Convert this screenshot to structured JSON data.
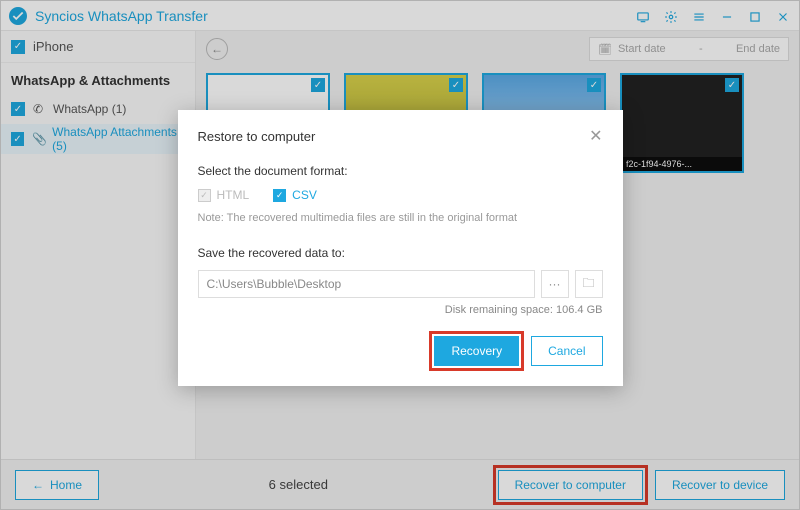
{
  "app": {
    "title": "Syncios WhatsApp Transfer"
  },
  "device": {
    "name": "iPhone"
  },
  "sidebar": {
    "section_title": "WhatsApp & Attachments",
    "items": [
      {
        "label": "WhatsApp (1)"
      },
      {
        "label": "WhatsApp Attachments (5)"
      }
    ]
  },
  "toolbar": {
    "start_date": "Start date",
    "dash": "-",
    "end_date": "End date"
  },
  "thumbs": [
    {
      "caption": ""
    },
    {
      "caption": ""
    },
    {
      "caption": ""
    },
    {
      "caption": "f2c-1f94-4976-..."
    }
  ],
  "footer": {
    "home": "Home",
    "selected": "6 selected",
    "recover_computer": "Recover to computer",
    "recover_device": "Recover to device"
  },
  "modal": {
    "title": "Restore to computer",
    "select_format": "Select the document format:",
    "html": "HTML",
    "csv": "CSV",
    "note": "Note: The recovered multimedia files are still in the original format",
    "save_to": "Save the recovered data to:",
    "path": "C:\\Users\\Bubble\\Desktop",
    "more": "···",
    "disk_space": "Disk remaining space: 106.4 GB",
    "recovery": "Recovery",
    "cancel": "Cancel"
  }
}
